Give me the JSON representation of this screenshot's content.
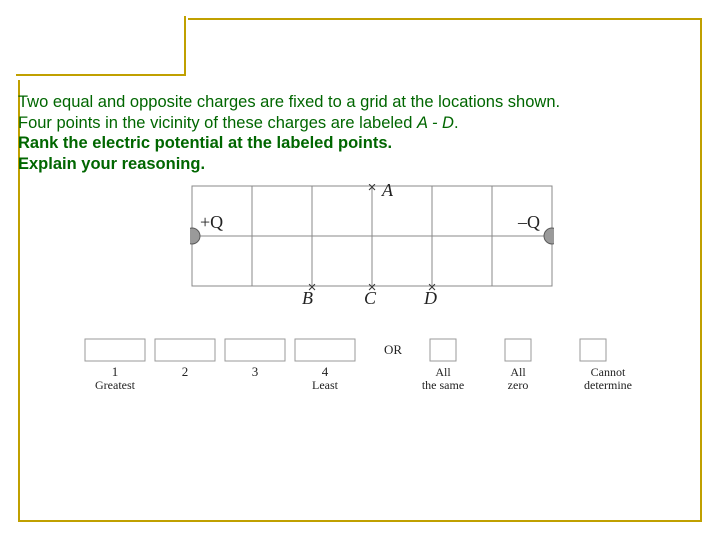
{
  "text": {
    "line1a": "Two equal and opposite charges are fixed to a grid at the locations shown.",
    "line2a": "Four points in the vicinity of these charges are labeled ",
    "line2b": "A - D",
    "line2c": ".",
    "line3": "Rank the electric potential at the labeled points.",
    "line4": "Explain your reasoning."
  },
  "diagram": {
    "plusQ": "+Q",
    "minusQ": "–Q",
    "A": "A",
    "B": "B",
    "C": "C",
    "D": "D"
  },
  "rank": {
    "or": "OR",
    "n1": "1",
    "n2": "2",
    "n3": "3",
    "n4": "4",
    "greatest": "Greatest",
    "least": "Least",
    "allsame1": "All",
    "allsame2": "the same",
    "allzero1": "All",
    "allzero2": "zero",
    "cannot1": "Cannot",
    "cannot2": "determine"
  }
}
